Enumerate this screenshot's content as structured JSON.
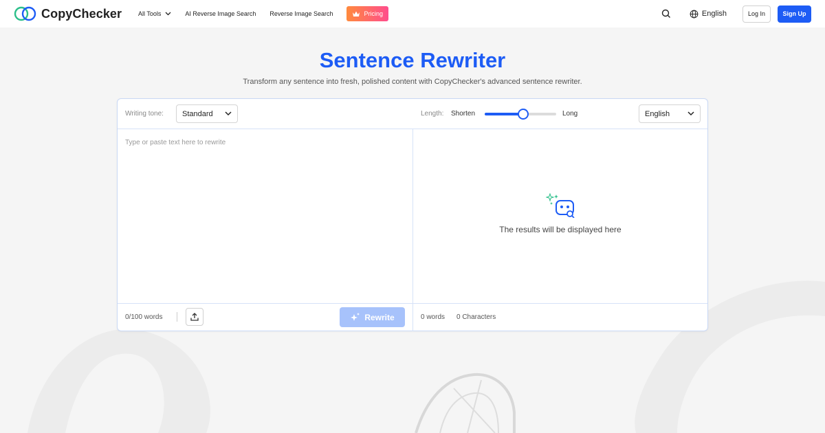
{
  "navbar": {
    "brand": "CopyChecker",
    "links": [
      "All Tools",
      "AI Reverse Image Search",
      "Reverse Image Search"
    ],
    "pricing_label": "Pricing",
    "language": "English",
    "login_label": "Log In",
    "signup_label": "Sign Up"
  },
  "hero": {
    "title": "Sentence Rewriter",
    "subtitle": "Transform any sentence into fresh, polished content with CopyChecker's advanced sentence rewriter."
  },
  "tool": {
    "tone_label": "Writing tone:",
    "tone_value": "Standard",
    "length_label": "Length:",
    "length_min_label": "Shorten",
    "length_max_label": "Long",
    "length_level": 0.54,
    "output_language": "English",
    "input_placeholder": "Type or paste text here to rewrite",
    "word_count": "0/100 words",
    "rewrite_label": "Rewrite",
    "result_placeholder": "The results will be displayed here",
    "output_words": "0 words",
    "output_chars": "0 Characters"
  },
  "colors": {
    "accent": "#1d5cf5",
    "rewrite_disabled": "#a7c2fb",
    "pricing_gradient_start": "#ff8a3d",
    "pricing_gradient_end": "#ff4d8d",
    "sparkle": "#2bbf8a"
  },
  "icons": [
    "logo-rings-icon",
    "chevron-down-icon",
    "crown-icon",
    "search-icon",
    "globe-icon",
    "upload-icon",
    "sparkle-icon",
    "robot-search-icon"
  ]
}
